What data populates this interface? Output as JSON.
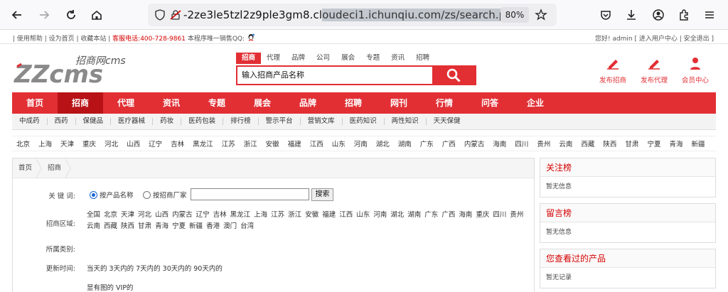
{
  "browser": {
    "url_prefix": "-2ze3le5tzl2z9ple3gm8.cl",
    "url_highlight": "oudeci1.ichunqiu.com/zs/search.php",
    "zoom": "80%"
  },
  "topbar": {
    "left_1": "| 使用帮助 | 设为首页 | 收藏本站 |",
    "service_label": "客服电话:400-728-9861",
    "left_2": "本程序唯一销售QQ:",
    "right": "您好! admin [ 进入用户中心 | 安全退出 ]"
  },
  "logo": {
    "small": "招商网cms",
    "big": "ZZcms"
  },
  "search": {
    "tabs": [
      "招商",
      "代理",
      "品牌",
      "公司",
      "展会",
      "专题",
      "资讯",
      "招聘"
    ],
    "value": "输入招商产品名称"
  },
  "header_buttons": [
    "发布招商",
    "发布代理",
    "会员中心"
  ],
  "mainnav": [
    "首页",
    "招商",
    "代理",
    "资讯",
    "专题",
    "展会",
    "品牌",
    "招聘",
    "网刊",
    "行情",
    "问答",
    "企业"
  ],
  "subnav": [
    "中成药",
    "西药",
    "保健品",
    "医疗器械",
    "药妆",
    "医药包装",
    "排行榜",
    "警示平台",
    "营销文库",
    "医药知识",
    "两性知识",
    "天天保健"
  ],
  "regions": [
    "北京",
    "上海",
    "天津",
    "重庆",
    "河北",
    "山西",
    "辽宁",
    "吉林",
    "黑龙江",
    "江苏",
    "浙江",
    "安徽",
    "福建",
    "江西",
    "山东",
    "河南",
    "湖北",
    "湖南",
    "广东",
    "广西",
    "内蒙古",
    "海南",
    "四川",
    "贵州",
    "云南",
    "西藏",
    "陕西",
    "甘肃",
    "宁夏",
    "青海",
    "新疆"
  ],
  "breadcrumb": [
    "首页",
    "招商"
  ],
  "form": {
    "kw_label": "关 键 词:",
    "opt_product": "按产品名称",
    "opt_company": "按招商厂家",
    "search_btn": "搜索",
    "area_label": "招商区域:",
    "areas": [
      "全国",
      "北京",
      "天津",
      "河北",
      "山西",
      "内蒙古",
      "辽宁",
      "吉林",
      "黑龙江",
      "上海",
      "江苏",
      "浙江",
      "安徽",
      "福建",
      "江西",
      "山东",
      "河南",
      "湖北",
      "湖南",
      "广东",
      "广西",
      "海南",
      "重庆",
      "四川",
      "贵州",
      "云南",
      "西藏",
      "陕西",
      "甘肃",
      "青海",
      "宁夏",
      "新疆",
      "香港",
      "澳门",
      "台湾"
    ],
    "category_label": "所属类别:",
    "update_label": "更新时间:",
    "update_opts": "当天的 3天内的 7天内的 30天内的 90天内的",
    "extra": "显有图的 VIP的"
  },
  "sidebar": [
    {
      "title": "关注榜",
      "body": "暂无信息"
    },
    {
      "title": "留言榜",
      "body": "暂无信息"
    },
    {
      "title": "您查看过的产品",
      "body": "暂无记录"
    }
  ],
  "colors": {
    "brand_red": "#e12f34",
    "active_nav": "#b81216"
  }
}
